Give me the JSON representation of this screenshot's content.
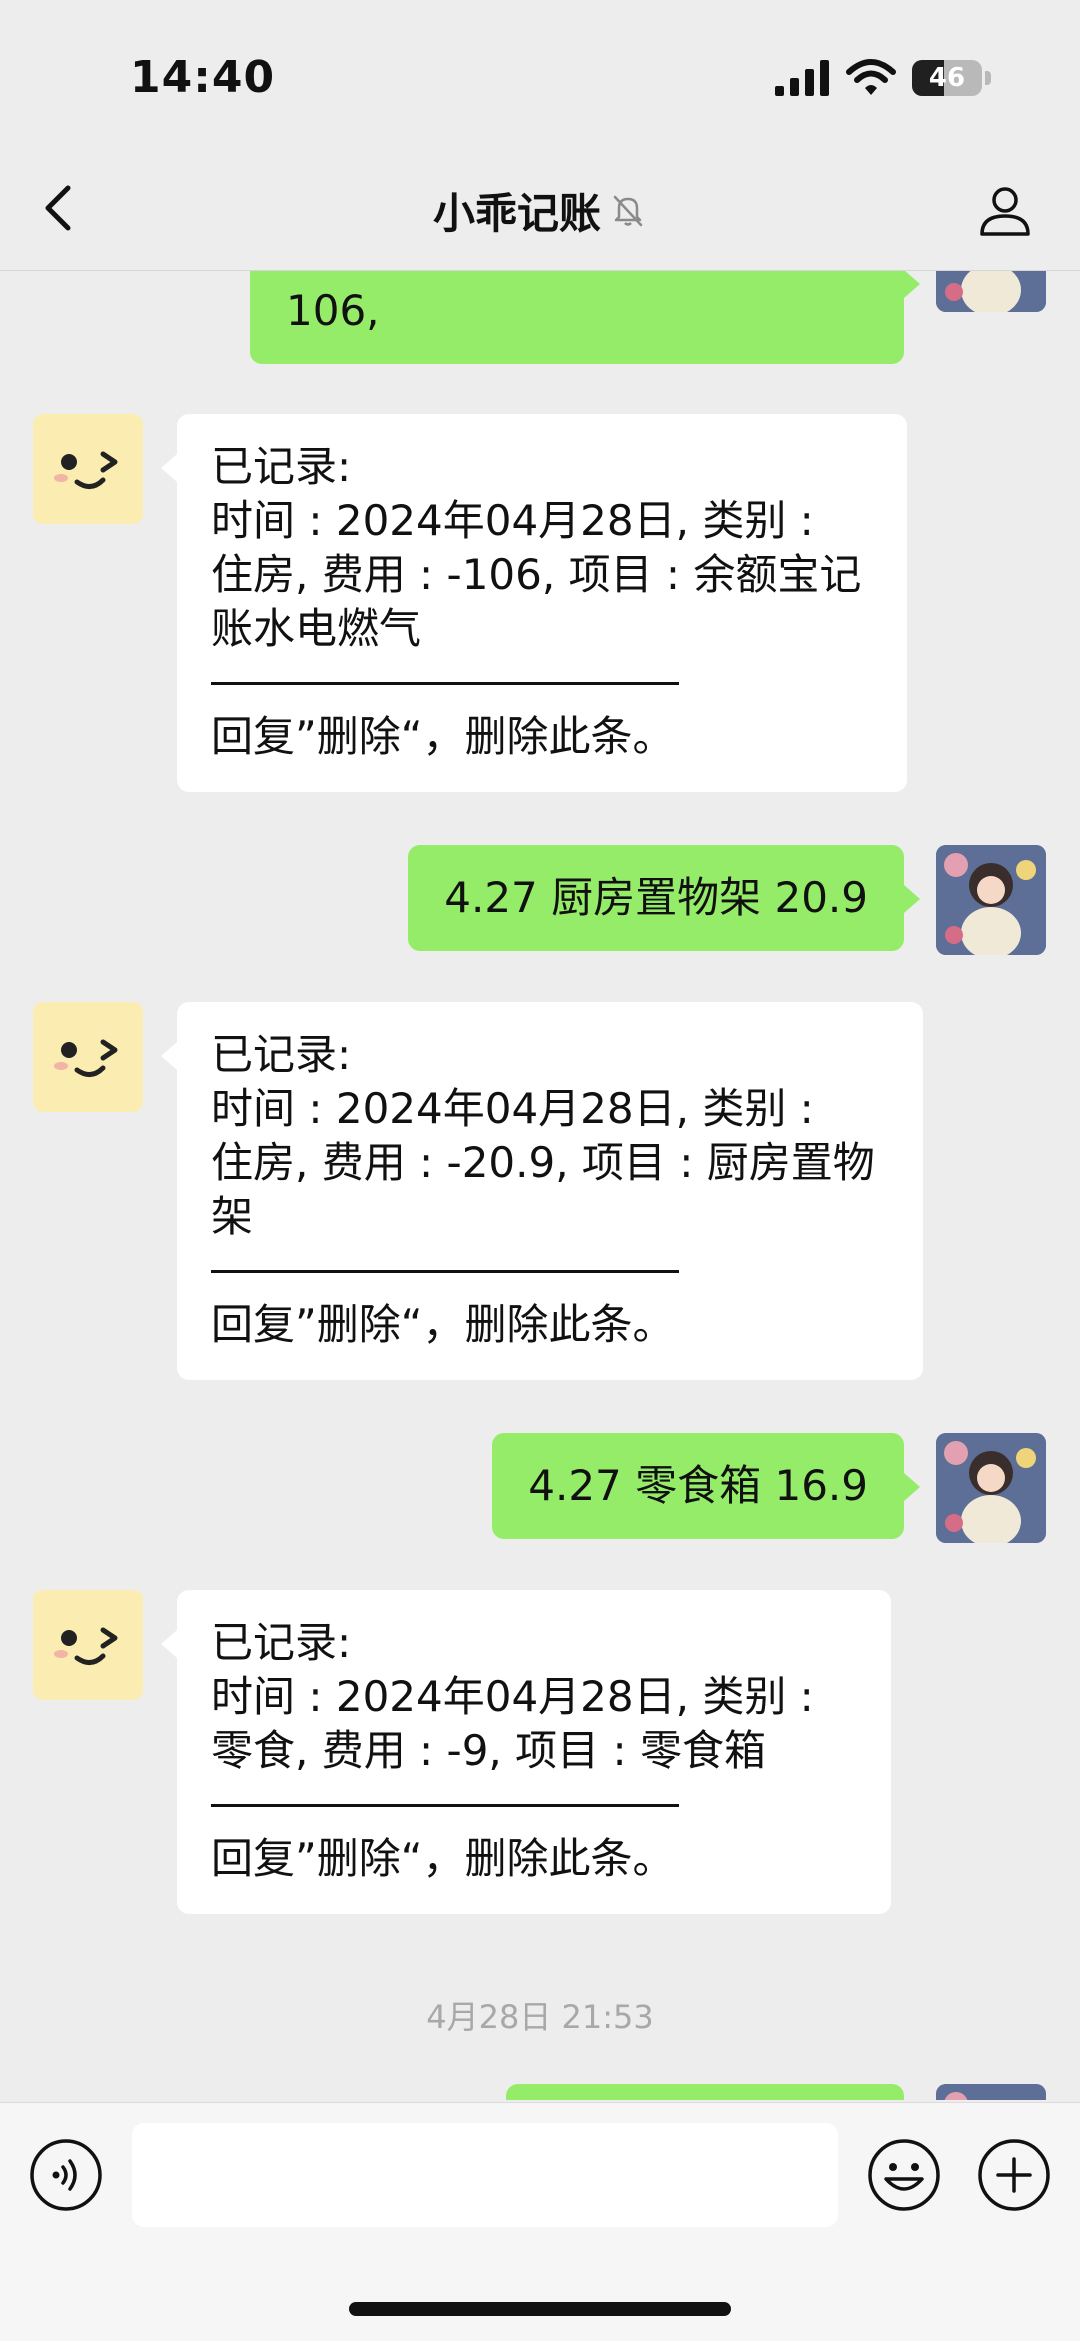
{
  "status_bar": {
    "time": "14:40",
    "battery": "46",
    "battery_level": 0.46
  },
  "nav": {
    "title": "小乖记账",
    "back_icon": "chevron-left-icon",
    "mute_icon": "bell-muted-icon",
    "profile_icon": "person-icon"
  },
  "messages": [
    {
      "from": "user",
      "lines": [
        "106,"
      ]
    },
    {
      "from": "bot",
      "lines": [
        "已记录:",
        "时间 : 2024年04月28日, 类别 :",
        "住房, 费用 : -106, 项目 : 余额宝记",
        "账水电燃气"
      ],
      "footer": "回复”删除“，删除此条。"
    },
    {
      "from": "user",
      "text": "4.27 厨房置物架 20.9"
    },
    {
      "from": "bot",
      "lines": [
        "已记录:",
        "时间 : 2024年04月28日, 类别 :",
        "住房, 费用 : -20.9, 项目 : 厨房置物",
        "架"
      ],
      "footer": "回复”删除“，删除此条。"
    },
    {
      "from": "user",
      "text": "4.27 零食箱 16.9"
    },
    {
      "from": "bot",
      "lines": [
        "已记录:",
        "时间 : 2024年04月28日, 类别 :",
        "零食, 费用 : -9, 项目 : 零食箱"
      ],
      "footer": "回复”删除“，删除此条。"
    }
  ],
  "timestamp": "4月28日 21:53",
  "input_bar": {
    "voice_icon": "voice-input-icon",
    "input_value": "",
    "emoji_icon": "emoji-icon",
    "plus_icon": "plus-circle-icon"
  },
  "colors": {
    "background": "#ededed",
    "user_bubble": "#95ec69",
    "bot_bubble": "#ffffff",
    "bot_avatar": "#fbedb1",
    "timestamp": "#a8a8a8"
  }
}
